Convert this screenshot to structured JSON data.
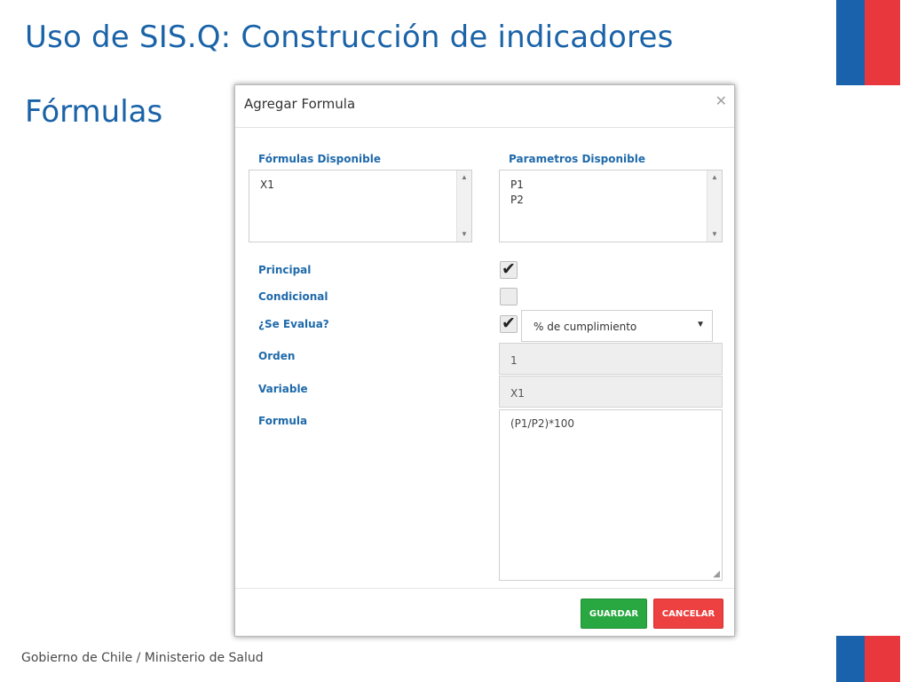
{
  "slide": {
    "title": "Uso de SIS.Q: Construcción de indicadores",
    "subtitle": "Fórmulas",
    "footer": "Gobierno de Chile / Ministerio de Salud",
    "colors": {
      "title": "#1a63a8",
      "flag_blue": "#1b62ac",
      "flag_red": "#e8383d"
    }
  },
  "modal": {
    "title": "Agregar Formula",
    "close_icon": "close-icon",
    "formulas": {
      "label": "Fórmulas Disponible",
      "items": [
        "X1"
      ]
    },
    "parametros": {
      "label": "Parametros Disponible",
      "items": [
        "P1",
        "P2"
      ]
    },
    "principal": {
      "label": "Principal",
      "checked": true
    },
    "condicional": {
      "label": "Condicional",
      "checked": false
    },
    "evalua": {
      "label": "¿Se Evalua?",
      "checked": true,
      "selected": "% de cumplimiento"
    },
    "orden": {
      "label": "Orden",
      "value": "1"
    },
    "variable": {
      "label": "Variable",
      "value": "X1"
    },
    "formula": {
      "label": "Formula",
      "value": "(P1/P2)*100"
    },
    "buttons": {
      "save": "GUARDAR",
      "cancel": "CANCELAR"
    },
    "colors": {
      "label": "#1f6aab",
      "save": "#29a841",
      "cancel": "#ed4040"
    }
  }
}
